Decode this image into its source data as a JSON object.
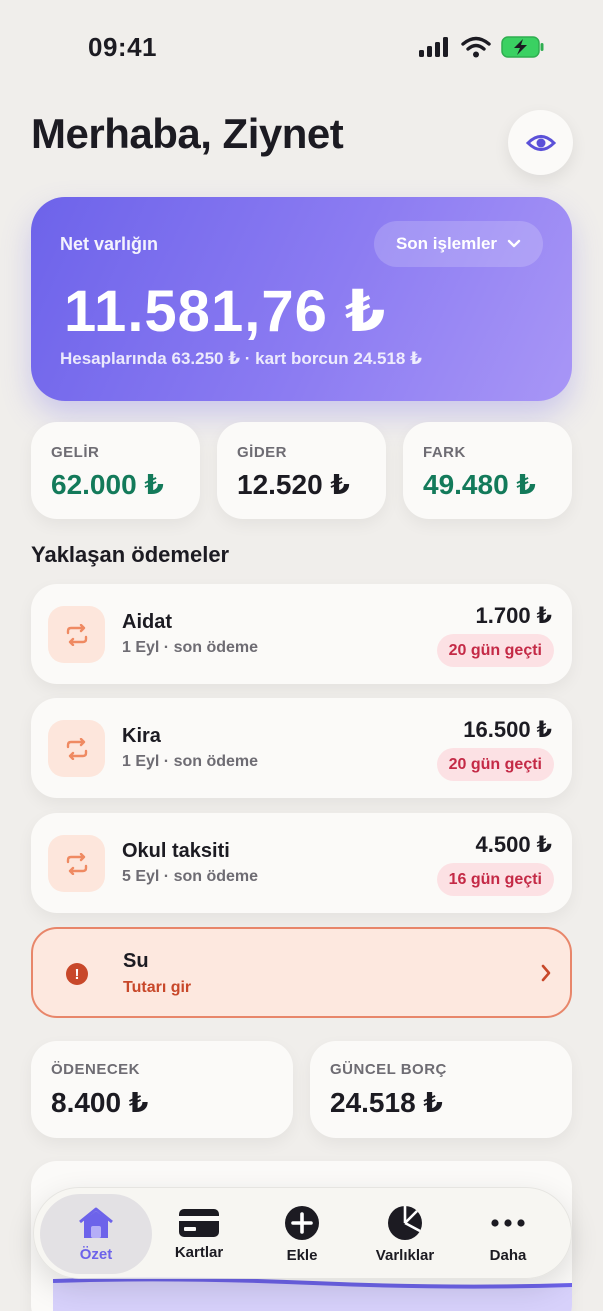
{
  "status_bar": {
    "time": "09:41"
  },
  "header": {
    "greeting": "Merhaba, Ziynet"
  },
  "net_worth": {
    "label": "Net varlığın",
    "value": "11.581,76 ₺",
    "subtitle": "Hesaplarında 63.250 ₺ · kart borcun 24.518 ₺",
    "period": "Son işlemler"
  },
  "stats": [
    {
      "label": "GELİR",
      "value": "62.000 ₺",
      "color": "#137a5a"
    },
    {
      "label": "GİDER",
      "value": "12.520 ₺",
      "color": "#1c1b22"
    },
    {
      "label": "FARK",
      "value": "49.480 ₺",
      "color": "#137a5a"
    }
  ],
  "upcoming": {
    "title": "Yaklaşan ödemeler",
    "items": [
      {
        "name": "Aidat",
        "sub": "1 Eyl · son ödeme",
        "amount": "1.700 ₺",
        "badge": "20 gün geçti"
      },
      {
        "name": "Kira",
        "sub": "1 Eyl · son ödeme",
        "amount": "16.500 ₺",
        "badge": "20 gün geçti"
      },
      {
        "name": "Okul taksiti",
        "sub": "5 Eyl · son ödeme",
        "amount": "4.500 ₺",
        "badge": "16 gün geçti"
      }
    ],
    "alert": {
      "name": "Su",
      "sub": "Tutarı gir"
    }
  },
  "summary": [
    {
      "label": "ÖDENECEK",
      "value": "8.400 ₺"
    },
    {
      "label": "GÜNCEL BORÇ",
      "value": "24.518 ₺"
    }
  ],
  "tabs": [
    {
      "label": "Özet",
      "icon": "home-icon",
      "active": true
    },
    {
      "label": "Kartlar",
      "icon": "card-icon"
    },
    {
      "label": "Ekle",
      "icon": "plus-circle-icon"
    },
    {
      "label": "Varlıklar",
      "icon": "pie-chart-icon"
    },
    {
      "label": "Daha",
      "icon": "more-icon"
    }
  ],
  "colors": {
    "accent": "#6d63ea",
    "positive": "#137a5a",
    "overdue": "#c42a46",
    "warning": "#c8482a"
  }
}
